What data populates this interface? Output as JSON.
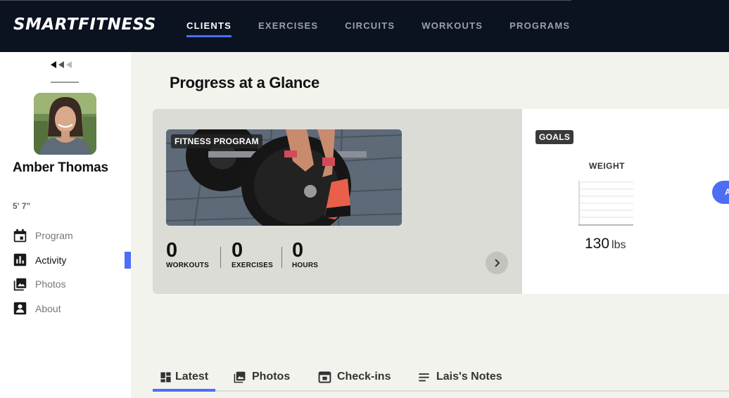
{
  "app": {
    "logo": "SMARTFITNESS"
  },
  "nav": {
    "items": [
      {
        "label": "CLIENTS",
        "active": true
      },
      {
        "label": "EXERCISES",
        "active": false
      },
      {
        "label": "CIRCUITS",
        "active": false
      },
      {
        "label": "WORKOUTS",
        "active": false
      },
      {
        "label": "PROGRAMS",
        "active": false
      }
    ]
  },
  "sidebar": {
    "client_name": "Amber Thomas",
    "height": "5' 7\"",
    "menu": [
      {
        "label": "Program",
        "icon": "calendar-icon",
        "active": false
      },
      {
        "label": "Activity",
        "icon": "bar-chart-icon",
        "active": true
      },
      {
        "label": "Photos",
        "icon": "photos-icon",
        "active": false
      },
      {
        "label": "About",
        "icon": "contact-card-icon",
        "active": false
      }
    ]
  },
  "main": {
    "title": "Progress at a Glance",
    "program_card": {
      "badge": "FITNESS PROGRAM",
      "stats": [
        {
          "value": "0",
          "label": "WORKOUTS"
        },
        {
          "value": "0",
          "label": "EXERCISES"
        },
        {
          "value": "0",
          "label": "HOURS"
        }
      ]
    },
    "goals_card": {
      "badge": "GOALS",
      "weight_label": "WEIGHT",
      "weight_value": "130",
      "weight_unit": "lbs",
      "edge_button_label": "A"
    },
    "tabs": [
      {
        "label": "Latest",
        "icon": "dashboard-icon",
        "active": true
      },
      {
        "label": "Photos",
        "icon": "photos-icon",
        "active": false
      },
      {
        "label": "Check-ins",
        "icon": "check-in-icon",
        "active": false
      },
      {
        "label": "Lais's Notes",
        "icon": "notes-icon",
        "active": false
      }
    ]
  },
  "colors": {
    "topbar": "#0b1220",
    "accent": "#4c6ef5",
    "page_bg": "#f3f3ee",
    "card_bg": "#dcdcd7"
  }
}
